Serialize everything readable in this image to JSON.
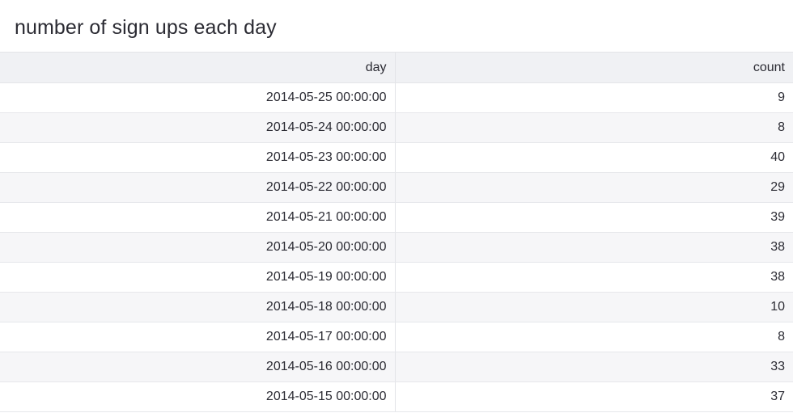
{
  "title": "number of sign ups each day",
  "chart_data": {
    "type": "table",
    "title": "number of sign ups each day",
    "columns": [
      "day",
      "count"
    ],
    "rows": [
      [
        "2014-05-25 00:00:00",
        "9"
      ],
      [
        "2014-05-24 00:00:00",
        "8"
      ],
      [
        "2014-05-23 00:00:00",
        "40"
      ],
      [
        "2014-05-22 00:00:00",
        "29"
      ],
      [
        "2014-05-21 00:00:00",
        "39"
      ],
      [
        "2014-05-20 00:00:00",
        "38"
      ],
      [
        "2014-05-19 00:00:00",
        "38"
      ],
      [
        "2014-05-18 00:00:00",
        "10"
      ],
      [
        "2014-05-17 00:00:00",
        "8"
      ],
      [
        "2014-05-16 00:00:00",
        "33"
      ],
      [
        "2014-05-15 00:00:00",
        "37"
      ]
    ]
  }
}
